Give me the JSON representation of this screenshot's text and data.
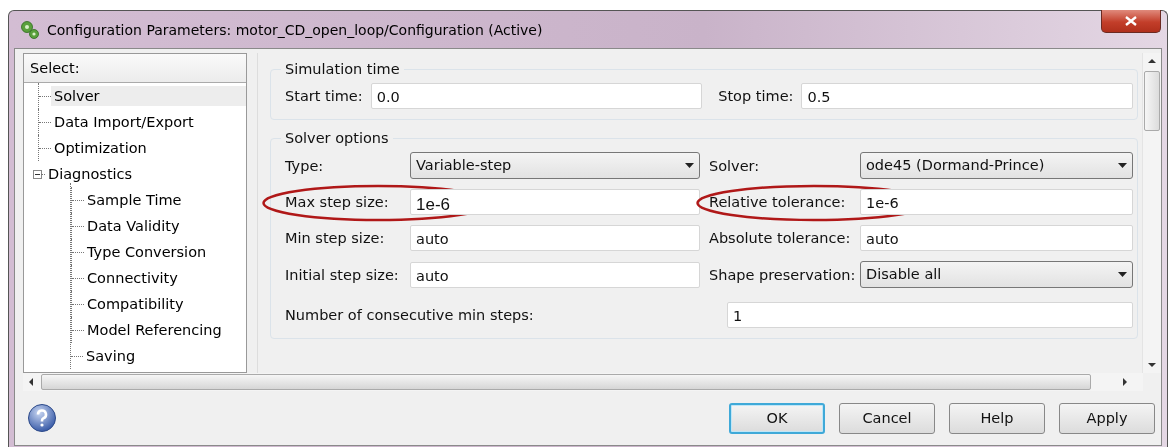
{
  "window": {
    "title": "Configuration Parameters: motor_CD_open_loop/Configuration (Active)"
  },
  "tree": {
    "header": "Select:",
    "items": [
      {
        "label": "Solver",
        "selected": true
      },
      {
        "label": "Data Import/Export",
        "selected": false
      },
      {
        "label": "Optimization",
        "selected": false
      },
      {
        "label": "Diagnostics",
        "selected": false,
        "expanded": true,
        "children": [
          {
            "label": "Sample Time",
            "selected": false
          },
          {
            "label": "Data Validity",
            "selected": false
          },
          {
            "label": "Type Conversion",
            "selected": false
          },
          {
            "label": "Connectivity",
            "selected": false
          },
          {
            "label": "Compatibility",
            "selected": false
          },
          {
            "label": "Model Referencing",
            "selected": false
          },
          {
            "label": "Saving",
            "selected": false
          }
        ]
      }
    ]
  },
  "simulation_time": {
    "title": "Simulation time",
    "fields": [
      {
        "label": "Start time:",
        "value": "0.0"
      },
      {
        "label": "Stop time:",
        "value": "0.5"
      }
    ]
  },
  "solver_options": {
    "title": "Solver options",
    "rows": [
      [
        {
          "kind": "dropdown",
          "label": "Type:",
          "value": "Variable-step",
          "annotated": false
        },
        {
          "kind": "dropdown",
          "label": "Solver:",
          "value": "ode45 (Dormand-Prince)",
          "annotated": false
        }
      ],
      [
        {
          "kind": "text",
          "label": "Max step size:",
          "value": "1e-6",
          "annotated": true
        },
        {
          "kind": "text",
          "label": "Relative tolerance:",
          "value": "1e-6",
          "annotated": true
        }
      ],
      [
        {
          "kind": "text",
          "label": "Min step size:",
          "value": "auto",
          "annotated": false
        },
        {
          "kind": "text",
          "label": "Absolute tolerance:",
          "value": "auto",
          "annotated": false
        }
      ],
      [
        {
          "kind": "text",
          "label": "Initial step size:",
          "value": "auto",
          "annotated": false
        },
        {
          "kind": "dropdown",
          "label": "Shape preservation:",
          "value": "Disable all",
          "annotated": false
        }
      ]
    ],
    "consecutive": {
      "label": "Number of consecutive min steps:",
      "value": "1"
    }
  },
  "buttons": [
    {
      "label": "OK",
      "focused": true
    },
    {
      "label": "Cancel",
      "focused": false
    },
    {
      "label": "Help",
      "focused": false
    },
    {
      "label": "Apply",
      "focused": false
    }
  ]
}
